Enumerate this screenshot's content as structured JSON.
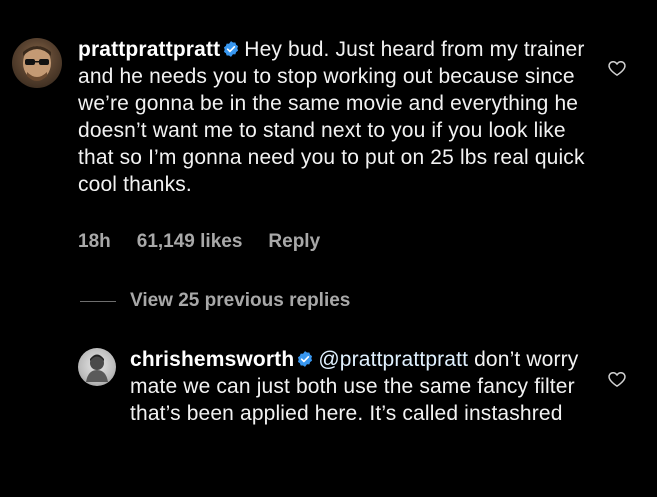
{
  "comments": [
    {
      "username": "prattprattpratt",
      "verified": true,
      "text": "Hey bud. Just heard from my trainer and he needs you to stop working out because since we’re gonna be in the same movie and everything he doesn’t want me to stand next to you if you look like that so I’m gonna need you to put on 25 lbs real quick cool thanks.",
      "time": "18h",
      "likes": "61,149 likes",
      "reply_label": "Reply",
      "avatar_icon": "person-sunglasses-avatar"
    },
    {
      "username": "chrishemsworth",
      "verified": true,
      "mention": "@prattprattpratt",
      "text": "don’t worry mate we can just both use the same fancy filter that’s been applied here. It’s called instashred",
      "avatar_icon": "person-bw-avatar"
    }
  ],
  "view_replies_label": "View 25 previous replies",
  "colors": {
    "background": "#000000",
    "text": "#f2f2f2",
    "secondary_text": "#a8a8a8",
    "verified_badge": "#3897f0"
  }
}
